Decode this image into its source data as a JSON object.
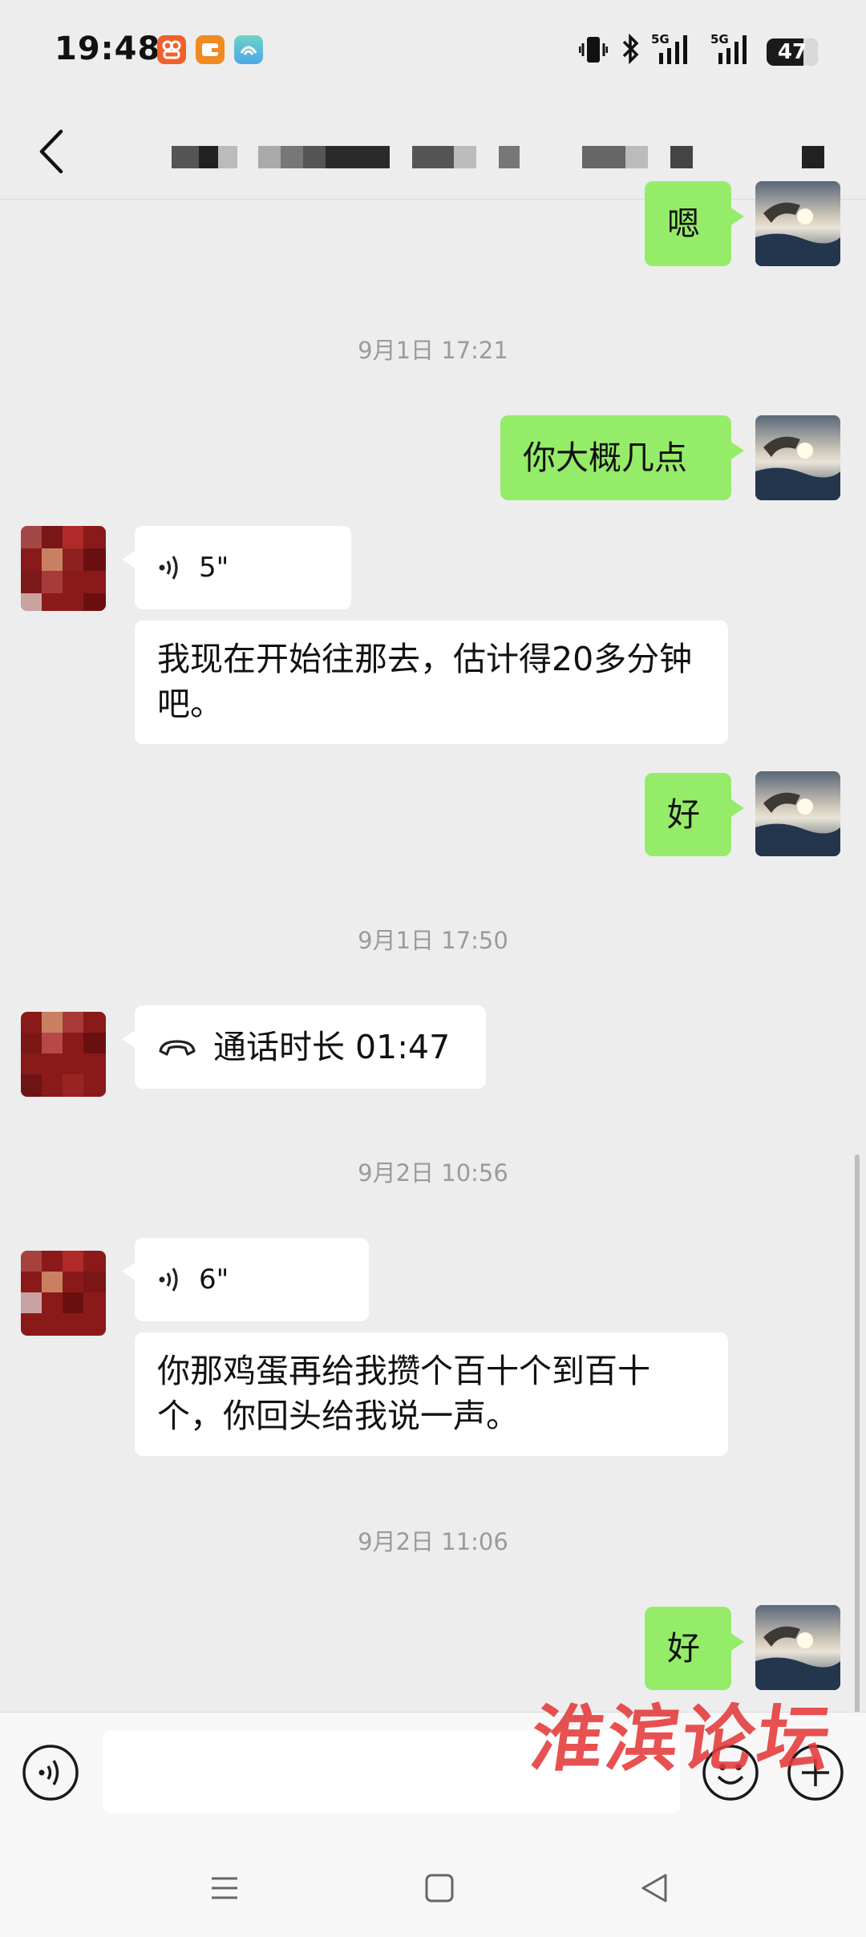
{
  "status_bar": {
    "time": "19:48",
    "network_1": "5G",
    "network_2": "5G",
    "battery_level": "47",
    "icons": [
      "app-icon-orange",
      "app-icon-wallet",
      "app-icon-green",
      "vibrate-icon",
      "bluetooth-icon",
      "signal-icon",
      "signal-icon",
      "battery-icon"
    ]
  },
  "header": {
    "back_icon": "chevron-left-icon",
    "title": "",
    "more_icon": "more-icon"
  },
  "messages": [
    {
      "type": "text",
      "from": "self",
      "text": "嗯"
    },
    {
      "type": "timestamp",
      "text": "9月1日 17:21"
    },
    {
      "type": "text",
      "from": "self",
      "text": "你大概几点"
    },
    {
      "type": "voice",
      "from": "other",
      "duration": "5\""
    },
    {
      "type": "text",
      "from": "other",
      "text": "我现在开始往那去，估计得20多分钟吧。"
    },
    {
      "type": "text",
      "from": "self",
      "text": "好"
    },
    {
      "type": "timestamp",
      "text": "9月1日 17:50"
    },
    {
      "type": "call",
      "from": "other",
      "text": "通话时长 01:47"
    },
    {
      "type": "timestamp",
      "text": "9月2日 10:56"
    },
    {
      "type": "voice",
      "from": "other",
      "duration": "6\""
    },
    {
      "type": "text",
      "from": "other",
      "text": "你那鸡蛋再给我攒个百十个到百十个，你回头给我说一声。"
    },
    {
      "type": "timestamp",
      "text": "9月2日 11:06"
    },
    {
      "type": "text",
      "from": "self",
      "text": "好"
    }
  ],
  "watermark": "淮滨论坛",
  "input_bar": {
    "voice_icon": "voice-input-icon",
    "input_value": "",
    "emoji_icon": "emoji-icon",
    "plus_icon": "plus-icon"
  },
  "nav_bar": {
    "icons": [
      "menu-icon",
      "home-icon",
      "back-triangle-icon"
    ]
  },
  "colors": {
    "background": "#ededed",
    "outgoing_bubble": "#95ec69",
    "incoming_bubble": "#ffffff",
    "timestamp": "#9b9b9b",
    "watermark": "#e53a3a"
  }
}
